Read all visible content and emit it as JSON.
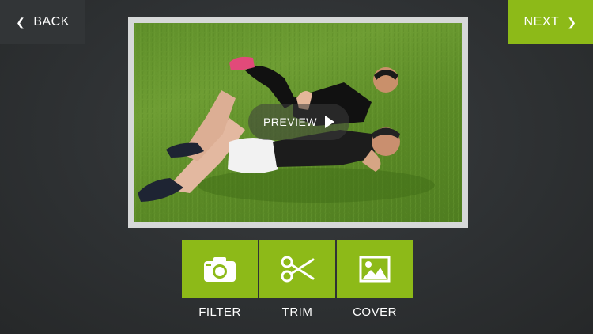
{
  "header": {
    "back_label": "BACK",
    "next_label": "NEXT",
    "back_icon": "chevron-left-icon",
    "next_icon": "chevron-right-icon"
  },
  "preview": {
    "label": "PREVIEW",
    "icon": "play-icon"
  },
  "tools": [
    {
      "label": "FILTER",
      "icon": "camera-icon"
    },
    {
      "label": "TRIM",
      "icon": "scissors-icon"
    },
    {
      "label": "COVER",
      "icon": "image-icon"
    }
  ],
  "colors": {
    "accent": "#8dba18",
    "background": "#2e3133",
    "frame": "#d6d8d8"
  }
}
